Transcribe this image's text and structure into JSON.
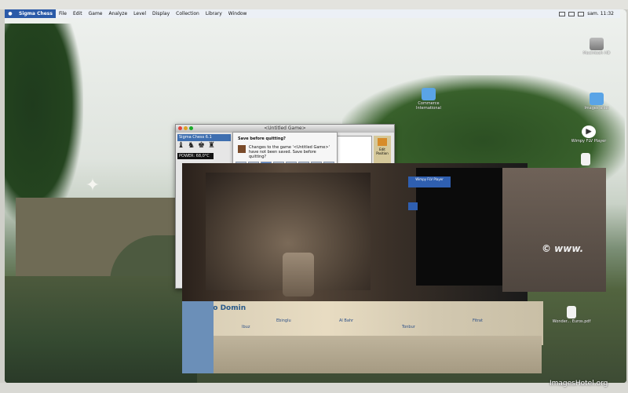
{
  "menubar": {
    "app_name": "Sigma Chess",
    "items": [
      "File",
      "Edit",
      "Game",
      "Analyze",
      "Level",
      "Display",
      "Collection",
      "Library",
      "Window"
    ],
    "clock": "sam. 11:32"
  },
  "desktop": {
    "icons": [
      {
        "label": "Macintosh HD",
        "icon": "hard-drive-icon"
      },
      {
        "label": "Commerce International",
        "icon": "folder-icon"
      },
      {
        "label": "Images alias",
        "icon": "folder-icon"
      },
      {
        "label": "Wimpy FLV Player",
        "icon": "video-player-icon"
      },
      {
        "label": "Wimpy FLV Player",
        "icon": "video-player-icon"
      },
      {
        "label": "Wonder... Euros.pdf",
        "icon": "document-icon"
      }
    ]
  },
  "window": {
    "title": "<Untitled Game>",
    "panel_title": "Sigma Chess 6.1",
    "power_label": "POWER: 68,0°C",
    "side_button": "Edit Position"
  },
  "sheet": {
    "heading": "Save before quitting?",
    "message": "Changes to the game '<Untitled Game>' have not been saved. Save before quitting?"
  },
  "photo_overlay": {
    "watermark": "© www.",
    "map_labels": [
      "Santo Domin",
      "Ebinglu",
      "Al Bahr",
      "Tonbur",
      "Fitrat",
      "Ibuz"
    ]
  },
  "site_tag": "ImagesHotel.org"
}
